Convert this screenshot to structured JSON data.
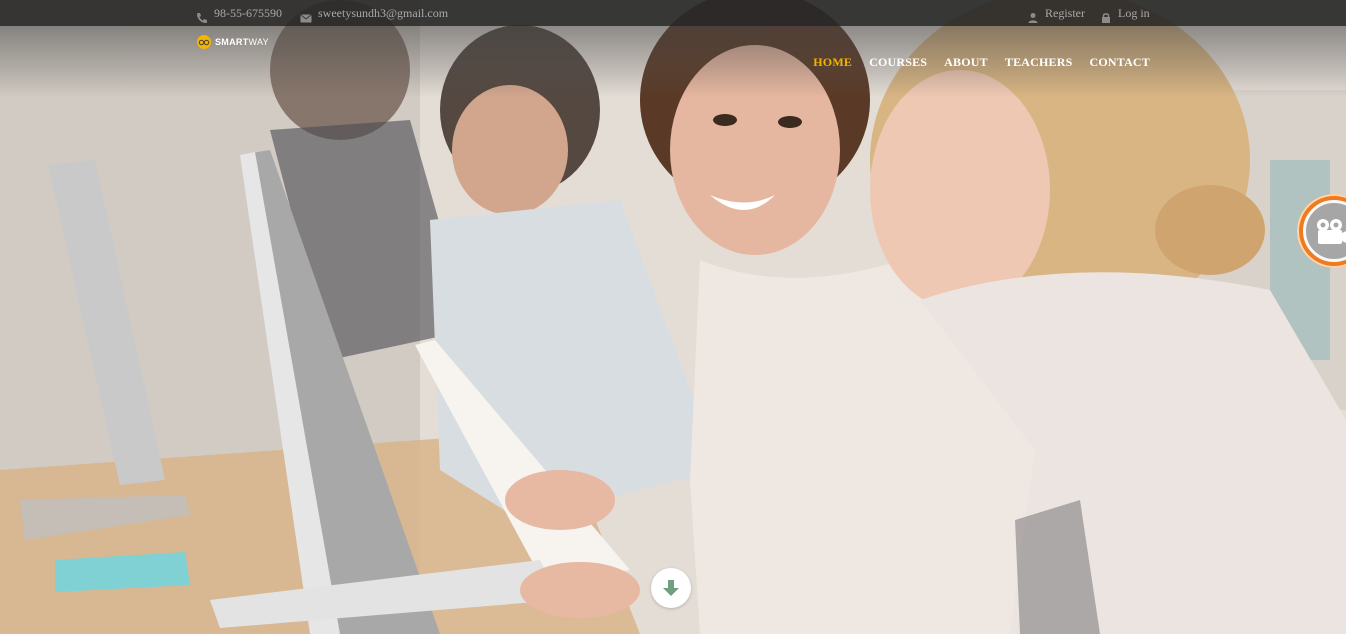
{
  "topbar": {
    "phone": "98-55-675590",
    "email": "sweetysundh3@gmail.com",
    "register": "Register",
    "login": "Log in"
  },
  "logo": {
    "brand_bold": "SMART",
    "brand_light": "WAY"
  },
  "nav": {
    "items": [
      {
        "label": "HOME",
        "active": true
      },
      {
        "label": "COURSES"
      },
      {
        "label": "ABOUT"
      },
      {
        "label": "TEACHERS"
      },
      {
        "label": "CONTACT"
      }
    ]
  },
  "icons": {
    "phone": "phone-icon",
    "email": "envelope-icon",
    "register": "user-icon",
    "login": "lock-icon",
    "scroll": "arrow-down-icon",
    "widget": "video-camera-icon"
  },
  "colors": {
    "accent": "#f5b400",
    "widget_ring": "#ef7a1f",
    "scroll_arrow": "#6f9f7d"
  }
}
